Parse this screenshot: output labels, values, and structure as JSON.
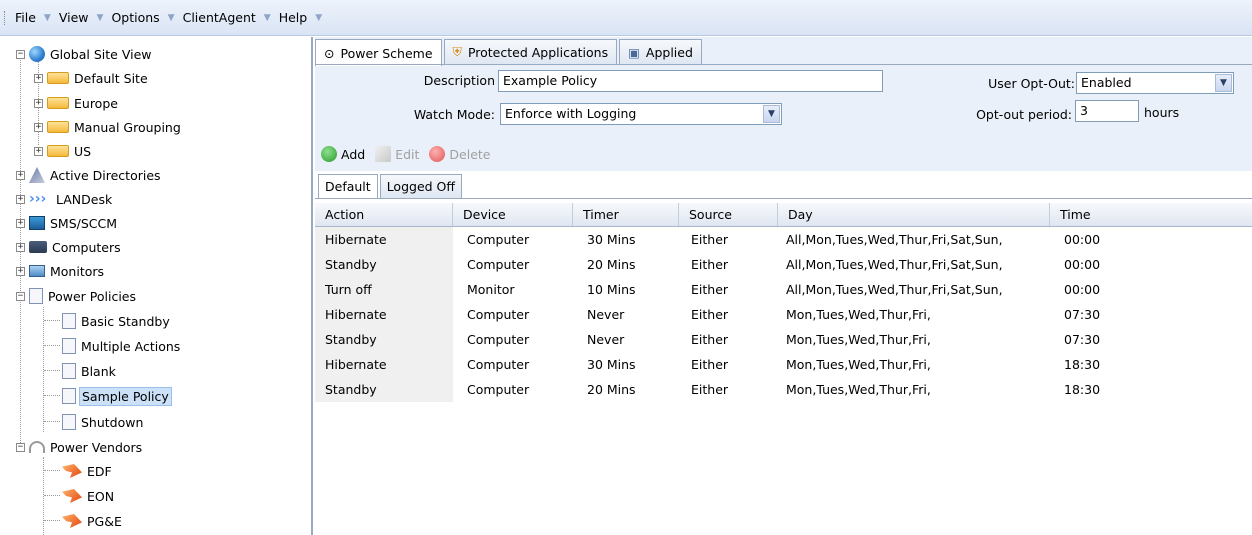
{
  "menu": [
    {
      "label": "File"
    },
    {
      "label": "View"
    },
    {
      "label": "Options"
    },
    {
      "label": "ClientAgent"
    },
    {
      "label": "Help"
    }
  ],
  "tree": {
    "global": "Global Site View",
    "default_site": "Default Site",
    "europe": "Europe",
    "manual_grouping": "Manual Grouping",
    "us": "US",
    "active_directories": "Active Directories",
    "landesk": "LANDesk",
    "sms": "SMS/SCCM",
    "computers": "Computers",
    "monitors": "Monitors",
    "power_policies": "Power Policies",
    "basic_standby": "Basic Standby",
    "multiple_actions": "Multiple Actions",
    "blank": "Blank",
    "sample_policy": "Sample Policy",
    "shutdown": "Shutdown",
    "power_vendors": "Power Vendors",
    "edf": "EDF",
    "eon": "EON",
    "pge": "PG&E"
  },
  "tabs": [
    {
      "label": "Power Scheme"
    },
    {
      "label": "Protected Applications"
    },
    {
      "label": "Applied"
    }
  ],
  "form": {
    "description_label": "Description",
    "description_value": "Example Policy",
    "watch_mode_label": "Watch Mode:",
    "watch_mode_value": "Enforce with Logging",
    "user_optout_label": "User Opt-Out:",
    "user_optout_value": "Enabled",
    "optout_period_label": "Opt-out period:",
    "optout_period_value": "3",
    "hours_label": "hours"
  },
  "toolbar": {
    "add": "Add",
    "edit": "Edit",
    "delete": "Delete"
  },
  "subtabs": [
    {
      "label": "Default"
    },
    {
      "label": "Logged Off"
    }
  ],
  "grid": {
    "columns": [
      "Action",
      "Device",
      "Timer",
      "Source",
      "Day",
      "Time"
    ],
    "rows": [
      [
        "Hibernate",
        "Computer",
        "30 Mins",
        "Either",
        "All,Mon,Tues,Wed,Thur,Fri,Sat,Sun,",
        "00:00"
      ],
      [
        "Standby",
        "Computer",
        "20 Mins",
        "Either",
        "All,Mon,Tues,Wed,Thur,Fri,Sat,Sun,",
        "00:00"
      ],
      [
        "Turn off",
        "Monitor",
        "10 Mins",
        "Either",
        "All,Mon,Tues,Wed,Thur,Fri,Sat,Sun,",
        "00:00"
      ],
      [
        "Hibernate",
        "Computer",
        "Never",
        "Either",
        "Mon,Tues,Wed,Thur,Fri,",
        "07:30"
      ],
      [
        "Standby",
        "Computer",
        "Never",
        "Either",
        "Mon,Tues,Wed,Thur,Fri,",
        "07:30"
      ],
      [
        "Hibernate",
        "Computer",
        "30 Mins",
        "Either",
        "Mon,Tues,Wed,Thur,Fri,",
        "18:30"
      ],
      [
        "Standby",
        "Computer",
        "20 Mins",
        "Either",
        "Mon,Tues,Wed,Thur,Fri,",
        "18:30"
      ]
    ]
  }
}
